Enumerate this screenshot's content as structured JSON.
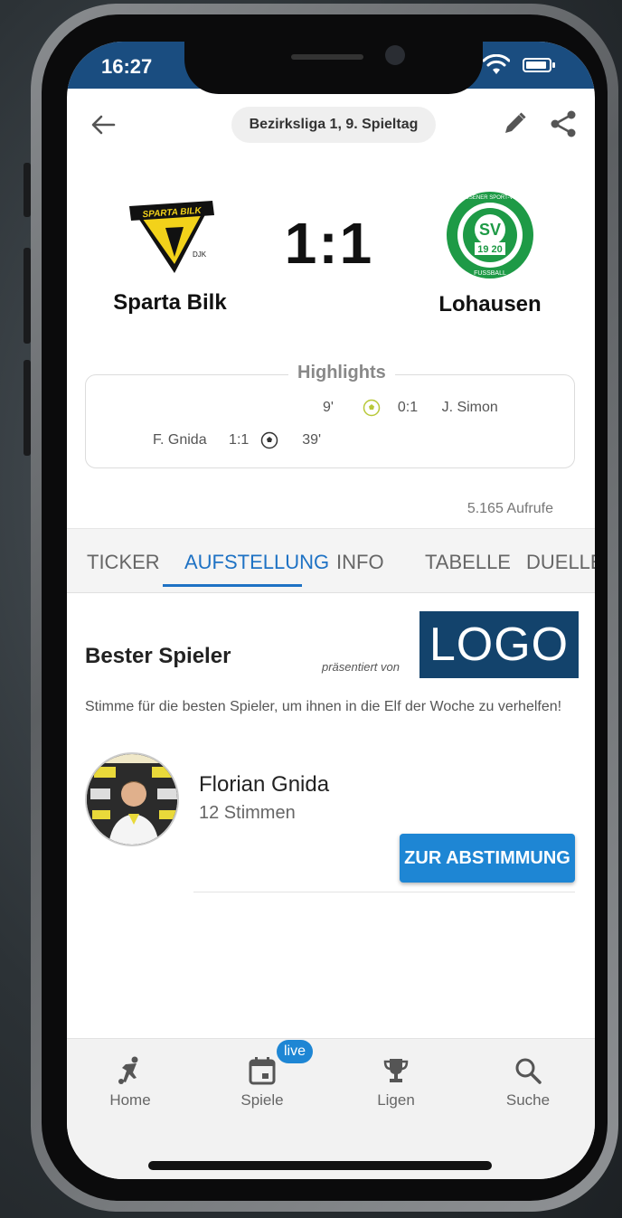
{
  "status_bar": {
    "time": "16:27"
  },
  "header": {
    "league": "Bezirksliga 1, 9. Spieltag"
  },
  "match": {
    "home_team": "Sparta Bilk",
    "away_team": "Lohausen",
    "score": "1:1",
    "home_logo_text": "SPARTA BILK",
    "home_logo_sub": "DJK",
    "away_logo_numbers": "19 20",
    "away_logo_ring": "LOHAUSENER SPORT-VEREIN",
    "away_logo_bottom": "FUSSBALL"
  },
  "highlights": {
    "title": "Highlights",
    "events": [
      {
        "minute": "9'",
        "score": "0:1",
        "player": "J. Simon",
        "side": "away"
      },
      {
        "minute": "39'",
        "score": "1:1",
        "player": "F. Gnida",
        "side": "home"
      }
    ]
  },
  "views": "5.165 Aufrufe",
  "tabs": [
    "TICKER",
    "AUFSTELLUNG",
    "INFO",
    "TABELLE",
    "DUELLE"
  ],
  "active_tab": "AUFSTELLUNG",
  "best_player": {
    "title": "Bester Spieler",
    "presented_by": "präsentiert von",
    "sponsor_logo": "LOGO",
    "description": "Stimme für die besten Spieler, um ihnen in die Elf der Woche zu verhelfen!",
    "player_name": "Florian Gnida",
    "votes": "12 Stimmen",
    "vote_button": "ZUR ABSTIMMUNG"
  },
  "bottom_nav": {
    "items": [
      {
        "label": "Home",
        "icon": "soccer-player-icon"
      },
      {
        "label": "Spiele",
        "icon": "calendar-icon"
      },
      {
        "label": "Ligen",
        "icon": "trophy-icon"
      },
      {
        "label": "Suche",
        "icon": "search-icon"
      }
    ],
    "live_badge": "live"
  },
  "colors": {
    "status_bar": "#1a4d80",
    "accent": "#1e72c4",
    "button": "#1e86d4",
    "sponsor_logo_bg": "#13436c"
  }
}
